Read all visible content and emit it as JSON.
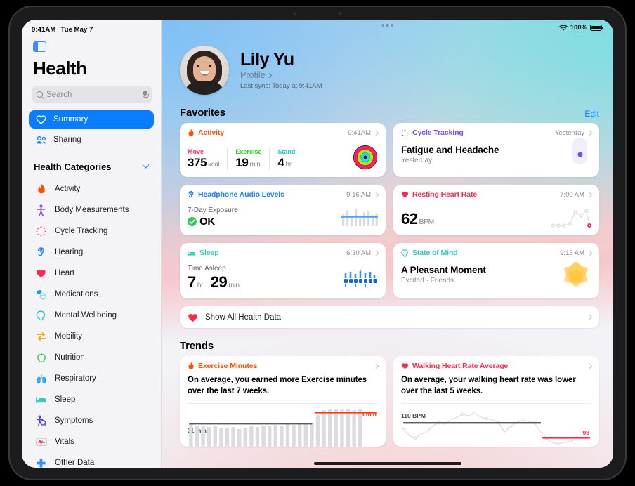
{
  "status_bar": {
    "time": "9:41AM",
    "date": "Tue May 7",
    "battery_percent": "100%",
    "wifi_icon": "wifi-icon",
    "battery_icon": "battery-icon"
  },
  "sidebar": {
    "toggle_icon": "sidebar-toggle-icon",
    "app_title": "Health",
    "search": {
      "placeholder": "Search",
      "value": "",
      "icon": "search-icon",
      "mic_icon": "microphone-icon"
    },
    "nav": [
      {
        "label": "Summary",
        "icon": "heart-outline-icon",
        "selected": true
      },
      {
        "label": "Sharing",
        "icon": "people-icon",
        "selected": false
      }
    ],
    "categories_header": {
      "label": "Health Categories",
      "chevron": "chevron-down-icon"
    },
    "categories": [
      {
        "label": "Activity",
        "icon": "flame-icon",
        "color": "#fc5200"
      },
      {
        "label": "Body Measurements",
        "icon": "body-icon",
        "color": "#8a4ae0"
      },
      {
        "label": "Cycle Tracking",
        "icon": "cycle-icon",
        "color": "#f2557f"
      },
      {
        "label": "Hearing",
        "icon": "ear-icon",
        "color": "#1e80ff"
      },
      {
        "label": "Heart",
        "icon": "heart-icon",
        "color": "#fa2b4d"
      },
      {
        "label": "Medications",
        "icon": "pills-icon",
        "color": "#1aa3e8"
      },
      {
        "label": "Mental Wellbeing",
        "icon": "head-icon",
        "color": "#2ec6bb"
      },
      {
        "label": "Mobility",
        "icon": "arrows-icon",
        "color": "#f5a623"
      },
      {
        "label": "Nutrition",
        "icon": "apple-icon",
        "color": "#2ec85b"
      },
      {
        "label": "Respiratory",
        "icon": "lungs-icon",
        "color": "#35a8ef"
      },
      {
        "label": "Sleep",
        "icon": "bed-icon",
        "color": "#35c9b6"
      },
      {
        "label": "Symptoms",
        "icon": "symptoms-icon",
        "color": "#5a3ee0"
      },
      {
        "label": "Vitals",
        "icon": "vitals-icon",
        "color": "#fa2b4d"
      },
      {
        "label": "Other Data",
        "icon": "plus-cross-icon",
        "color": "#3a8ef5"
      }
    ]
  },
  "profile": {
    "avatar": "user-avatar",
    "name": "Lily Yu",
    "profile_link": "Profile",
    "last_sync": "Last sync: Today at 9:41AM"
  },
  "favorites": {
    "heading": "Favorites",
    "edit_label": "Edit",
    "cards": {
      "activity": {
        "title": "Activity",
        "color": "#fc5200",
        "icon": "flame-icon",
        "time": "9:41AM",
        "metrics": [
          {
            "label": "Move",
            "color": "#fa2b56",
            "value": "375",
            "unit": "kcal"
          },
          {
            "label": "Exercise",
            "color": "#4ee14e",
            "value": "19",
            "unit": "min"
          },
          {
            "label": "Stand",
            "color": "#3ad5e8",
            "value": "4",
            "unit": "hr"
          }
        ],
        "rings_icon": "activity-rings-icon"
      },
      "cycle_tracking": {
        "title": "Cycle Tracking",
        "color": "#7b4df0",
        "icon": "cycle-icon",
        "time": "Yesterday",
        "headline": "Fatigue and Headache",
        "subline": "Yesterday",
        "marker_icon": "cycle-day-marker"
      },
      "headphone_audio": {
        "title": "Headphone Audio Levels",
        "color": "#1e80ff",
        "icon": "ear-icon",
        "time": "9:16 AM",
        "label": "7-Day Exposure",
        "status": "OK",
        "status_icon": "check-circle-icon",
        "status_color": "#2ec85b",
        "chart_icon": "audio-bars-chart"
      },
      "resting_heart_rate": {
        "title": "Resting Heart Rate",
        "color": "#fa2b4d",
        "icon": "heart-icon",
        "time": "7:00 AM",
        "value": "62",
        "unit": "BPM",
        "chart_icon": "heart-rate-line-chart"
      },
      "sleep": {
        "title": "Sleep",
        "color": "#35c9b6",
        "icon": "bed-icon",
        "time": "6:30 AM",
        "label": "Time Asleep",
        "value_hr": "7",
        "unit_hr": "hr",
        "value_min": "29",
        "unit_min": "min",
        "chart_icon": "sleep-stages-chart"
      },
      "state_of_mind": {
        "title": "State of Mind",
        "color": "#2ec6bb",
        "icon": "head-icon",
        "time": "9:15 AM",
        "headline": "A Pleasant Moment",
        "subline": "Excited · Friends",
        "shape_icon": "pleasant-star-icon"
      }
    },
    "show_all": {
      "label": "Show All Health Data",
      "icon": "heart-icon"
    }
  },
  "trends": {
    "heading": "Trends",
    "cards": {
      "exercise_minutes": {
        "title": "Exercise Minutes",
        "color": "#fc5200",
        "icon": "flame-icon",
        "text": "On average, you earned more Exercise minutes over the last 7 weeks.",
        "baseline_label": "31 min",
        "recent_label": "63 min"
      },
      "walking_heart_rate": {
        "title": "Walking Heart Rate Average",
        "color": "#fa2b4d",
        "icon": "heart-icon",
        "text": "On average, your walking heart rate was lower over the last 5 weeks.",
        "baseline_label": "110 BPM",
        "recent_label": "98"
      }
    }
  },
  "chart_data": [
    {
      "type": "bar",
      "title": "Exercise Minutes",
      "ylabel": "minutes",
      "baseline_value": 31,
      "recent_value": 63,
      "baseline_label": "31 min",
      "recent_label": "63 min",
      "baseline_color": "#5c5c60",
      "recent_color": "#ff3b0f",
      "bar_color": "#dcdce0",
      "values": [
        30,
        29,
        28,
        27,
        29,
        26,
        25,
        27,
        24,
        26,
        28,
        27,
        29,
        28,
        30,
        29,
        31,
        30,
        32,
        31,
        33,
        46,
        58,
        60,
        62,
        61,
        63,
        59,
        61
      ],
      "legend_position": "inline"
    },
    {
      "type": "line",
      "title": "Walking Heart Rate Average",
      "ylabel": "BPM",
      "baseline_value": 110,
      "recent_value": 98,
      "baseline_label": "110 BPM",
      "recent_label": "98",
      "baseline_color": "#5c5c60",
      "recent_color": "#fa2b4d",
      "line_color": "#dcdce0",
      "values": [
        104,
        99,
        97,
        101,
        103,
        108,
        110,
        109,
        112,
        114,
        116,
        115,
        117,
        114,
        113,
        112,
        110,
        105,
        108,
        111,
        113,
        112,
        111,
        106,
        101,
        97,
        96,
        97,
        98,
        99
      ],
      "legend_position": "inline"
    }
  ]
}
